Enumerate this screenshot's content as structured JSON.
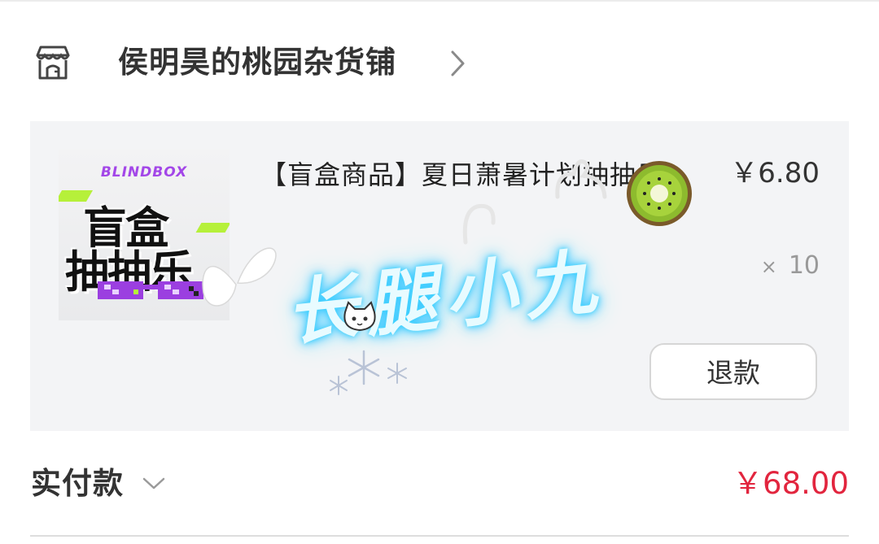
{
  "store": {
    "name": "侯明昊的桃园杂货铺",
    "icon": "storefront-icon",
    "chevron_icon": "chevron-right-icon"
  },
  "item": {
    "thumbnail": {
      "brand": "BLINDBOX",
      "line1": "盲盒",
      "line2": "抽抽乐"
    },
    "title": "【盲盒商品】夏日萧暑计划抽抽乐",
    "price": "￥6.80",
    "quantity_symbol": "×",
    "quantity": "10",
    "refund_label": "退款"
  },
  "overlay": {
    "neon_text": "长腿小九",
    "stickers": [
      "butterfly-icon",
      "kiwi-icon",
      "cat-face-icon",
      "snowflake-icon",
      "bunny-icon"
    ]
  },
  "payment": {
    "label": "实付款",
    "chevron_icon": "chevron-down-icon",
    "amount": "￥68.00"
  },
  "colors": {
    "accent_price": "#e2253e",
    "card_bg": "#f3f4f6",
    "brand_purple": "#a347e8",
    "neon_glow": "#39d6ff"
  }
}
